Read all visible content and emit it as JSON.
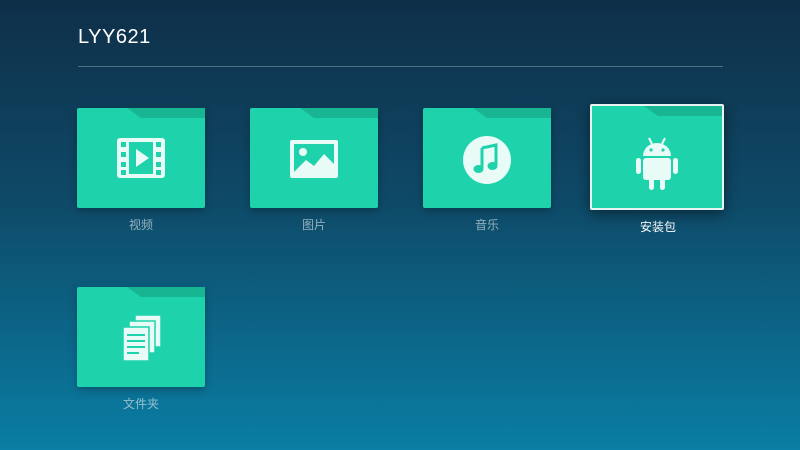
{
  "header": {
    "title": "LYY621"
  },
  "tiles": [
    {
      "label": "视频",
      "icon": "video-icon"
    },
    {
      "label": "图片",
      "icon": "image-icon"
    },
    {
      "label": "音乐",
      "icon": "music-icon"
    },
    {
      "label": "安装包",
      "icon": "android-icon",
      "focused": true
    },
    {
      "label": "文件夹",
      "icon": "documents-icon"
    }
  ],
  "colors": {
    "folder": "#1ed3ac",
    "folder_tab": "#18b592",
    "icon": "#e9fbf6"
  }
}
